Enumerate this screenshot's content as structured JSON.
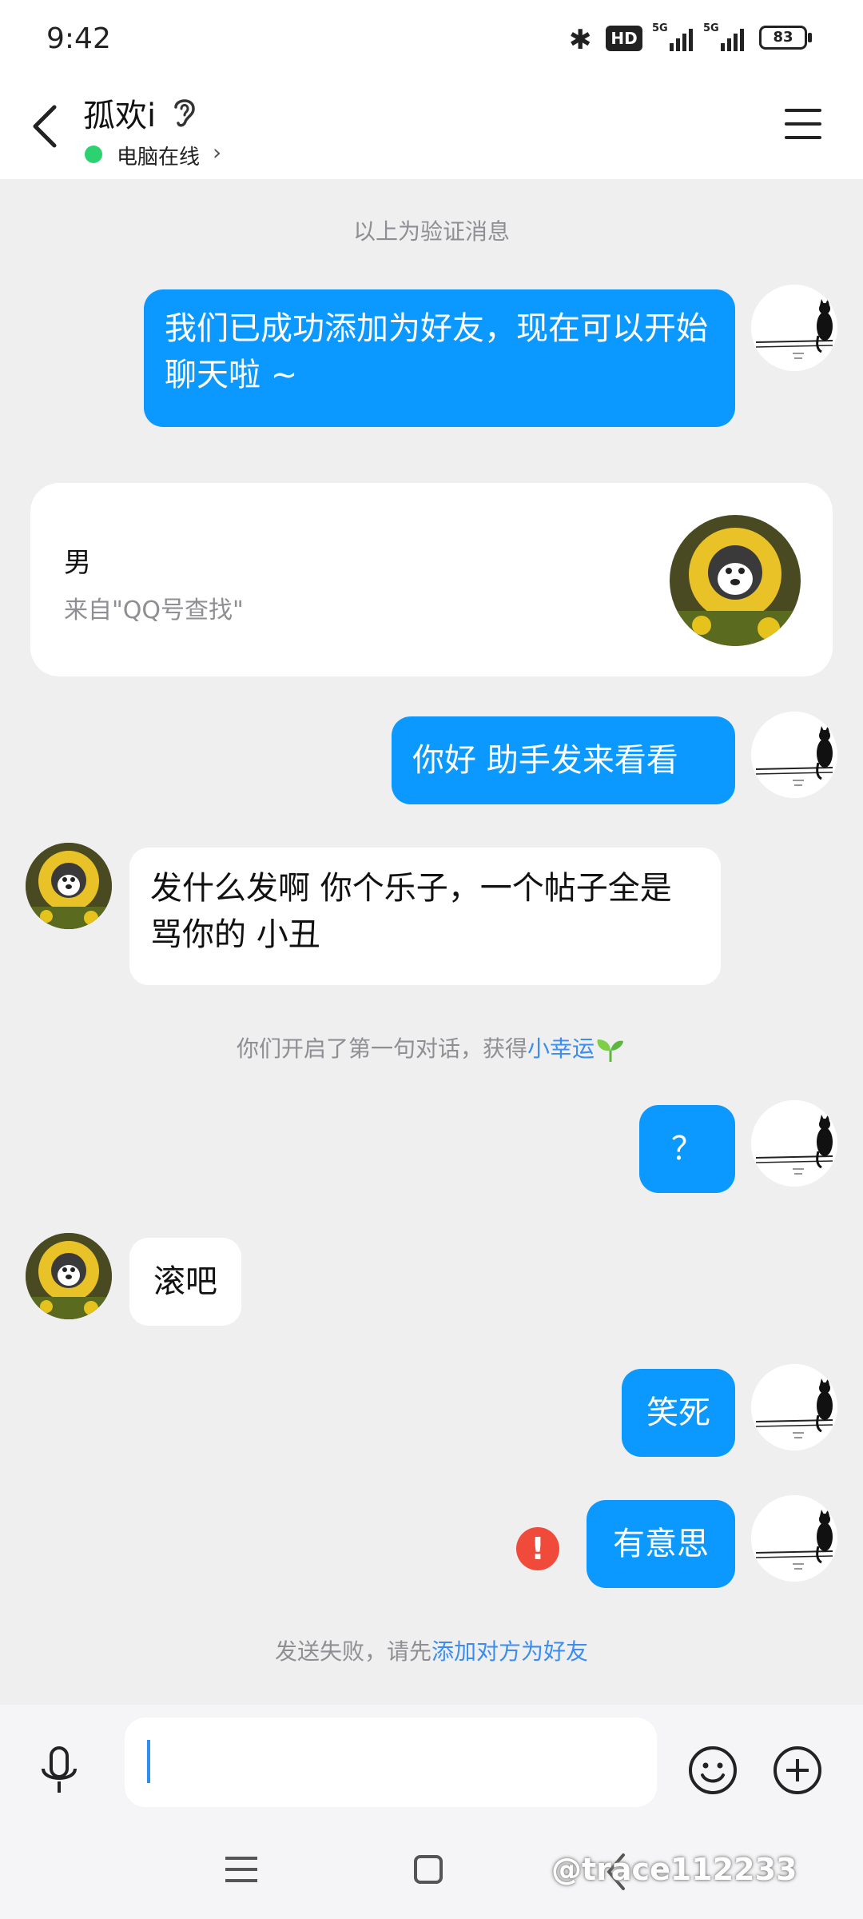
{
  "status_bar": {
    "time": "9:42",
    "hd_badge": "HD",
    "signal_1": "5G",
    "signal_2": "5G",
    "battery": "83"
  },
  "header": {
    "chat_name": "孤欢i",
    "online_status": "电脑在线",
    "online_arrow": "›"
  },
  "notices": {
    "verification": "以上为验证消息",
    "first_chat_prefix": "你们开启了第一句对话，获得",
    "first_chat_link": "小幸运",
    "send_failed_prefix": "发送失败，请先",
    "send_failed_link": "添加对方为好友"
  },
  "profile_card": {
    "gender": "男",
    "source": "来自\"QQ号查找\""
  },
  "messages": [
    {
      "side": "out",
      "text": "我们已成功添加为好友，现在可以开始聊天啦 ~"
    },
    {
      "side": "out",
      "text": "你好 助手发来看看"
    },
    {
      "side": "in",
      "text": "发什么发啊 你个乐子，一个帖子全是骂你的  小丑"
    },
    {
      "side": "out",
      "text": "？"
    },
    {
      "side": "in",
      "text": "滚吧"
    },
    {
      "side": "out",
      "text": "笑死"
    },
    {
      "side": "out",
      "text": "有意思",
      "failed": true
    }
  ],
  "fail_icon": "!",
  "input": {
    "value": "",
    "placeholder": ""
  },
  "watermark": "@trace112233",
  "colors": {
    "accent": "#0c99ff",
    "online": "#2bd26f",
    "error": "#f04a3a",
    "link": "#3b8df0",
    "background": "#efeff0"
  },
  "icons": [
    "back-arrow-icon",
    "ear-icon",
    "menu-icon",
    "mic-icon",
    "emoji-icon",
    "plus-icon",
    "leaf-icon"
  ]
}
